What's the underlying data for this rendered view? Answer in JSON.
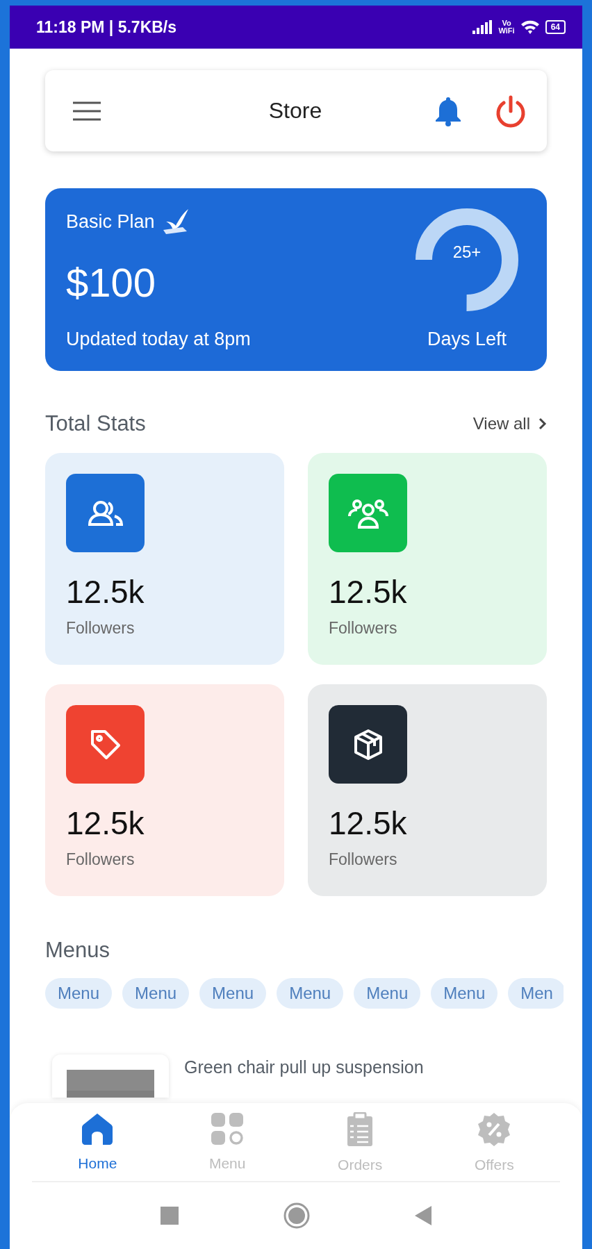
{
  "status_bar": {
    "time": "11:18 PM | 5.7KB/s",
    "vowifi": "Vo\nWiFi",
    "battery": "64"
  },
  "header": {
    "title": "Store"
  },
  "plan": {
    "name": "Basic Plan",
    "price": "$100",
    "updated": "Updated today at 8pm",
    "days": "25+",
    "days_label": "Days Left",
    "level": 0.75
  },
  "stats": {
    "title": "Total Stats",
    "view_all": "View all",
    "cards": [
      {
        "kind": "users",
        "color": "#1d6fd6",
        "value": "12.5k",
        "label": "Followers"
      },
      {
        "kind": "group",
        "color": "#0fbd4f",
        "value": "12.5k",
        "label": "Followers"
      },
      {
        "kind": "tag",
        "color": "#ef4331",
        "value": "12.5k",
        "label": "Followers"
      },
      {
        "kind": "box",
        "color": "#212b36",
        "value": "12.5k",
        "label": "Followers"
      }
    ]
  },
  "menus": {
    "title": "Menus",
    "chips": [
      "Menu",
      "Menu",
      "Menu",
      "Menu",
      "Menu",
      "Menu",
      "Men"
    ]
  },
  "products": [
    {
      "name": "Green chair pull up suspension"
    }
  ],
  "bottom_nav": [
    {
      "kind": "home",
      "label": "Home",
      "selected": true
    },
    {
      "kind": "menu",
      "label": "Menu",
      "selected": false
    },
    {
      "kind": "orders",
      "label": "Orders",
      "selected": false
    },
    {
      "kind": "offers",
      "label": "Offers",
      "selected": false
    }
  ]
}
